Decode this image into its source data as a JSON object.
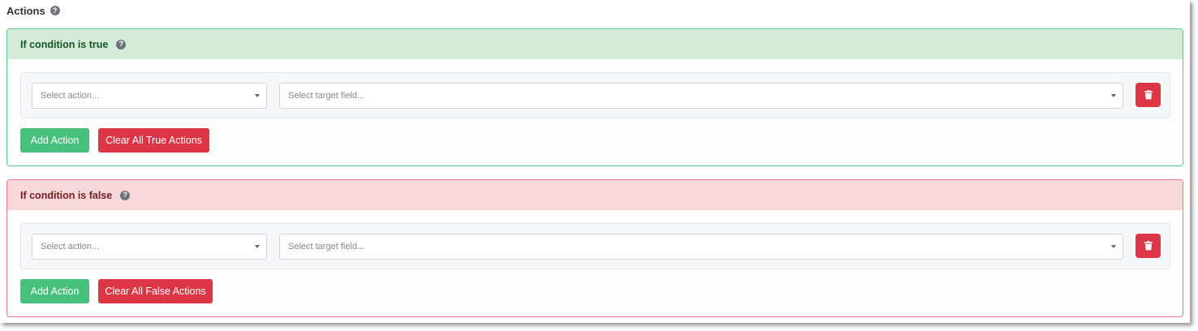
{
  "actions": {
    "title": "Actions",
    "help_glyph": "?"
  },
  "true_block": {
    "header": "If condition is true",
    "help_glyph": "?",
    "action_placeholder": "Select action...",
    "target_placeholder": "Select target field...",
    "add_label": "Add Action",
    "clear_label": "Clear All True Actions"
  },
  "false_block": {
    "header": "If condition is false",
    "help_glyph": "?",
    "action_placeholder": "Select action...",
    "target_placeholder": "Select target field...",
    "add_label": "Add Action",
    "clear_label": "Clear All False Actions"
  },
  "icons": {
    "help": "question-circle-icon",
    "delete": "trash-icon",
    "dropdown": "chevron-down-icon"
  },
  "colors": {
    "success": "#48c07d",
    "danger": "#dc3545",
    "true_header_bg": "#d4ebd9",
    "false_header_bg": "#f7d7da"
  }
}
